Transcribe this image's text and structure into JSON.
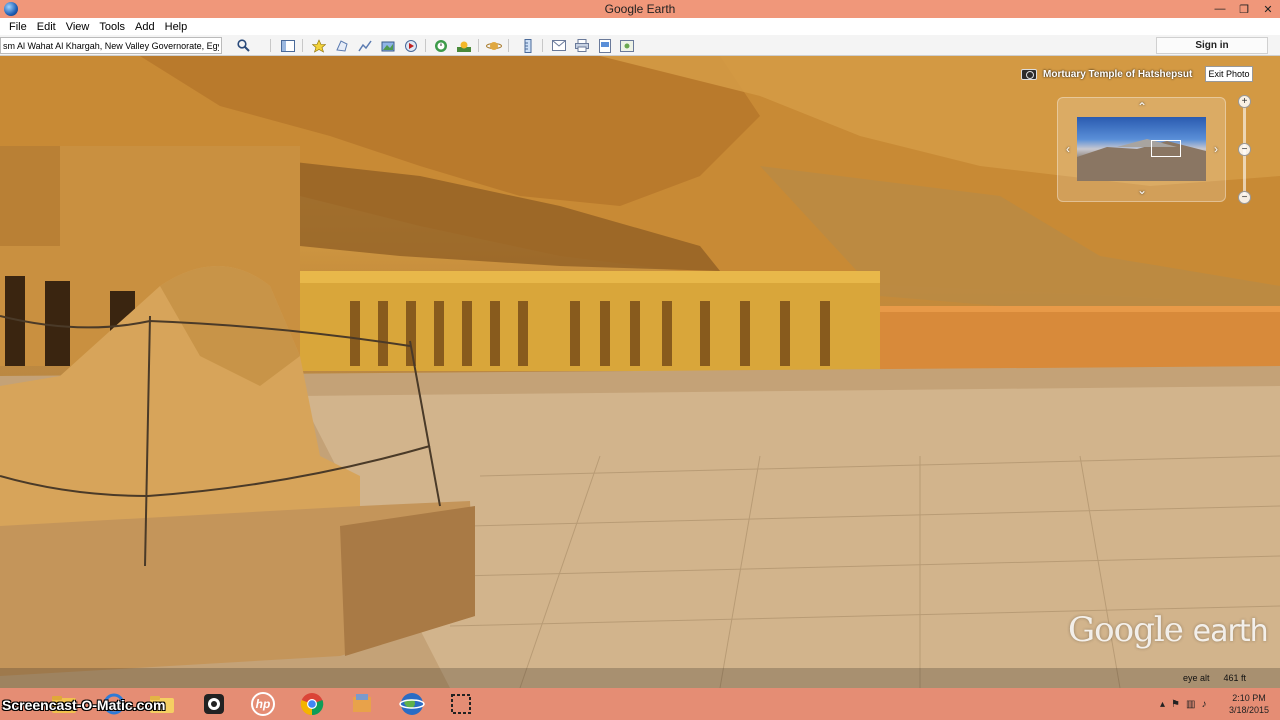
{
  "window": {
    "title": "Google Earth"
  },
  "window_controls": {
    "minimize": "—",
    "restore": "❐",
    "close": "✕"
  },
  "menu": [
    "File",
    "Edit",
    "View",
    "Tools",
    "Add",
    "Help"
  ],
  "toolbar": {
    "search_value": "sm Al Wahat Al Khargah, New Valley Governorate, Egypt",
    "sign_in_label": "Sign in",
    "tool_icons": [
      "search-icon",
      "sidebar-icon",
      "placemark-icon",
      "polygon-icon",
      "path-icon",
      "image-overlay-icon",
      "tour-icon",
      "historical-imagery-icon",
      "sun-icon",
      "planets-icon",
      "ruler-icon",
      "email-icon",
      "print-icon",
      "save-image-icon",
      "maps-icon"
    ]
  },
  "photo": {
    "title": "Mortuary Temple of Hatshepsut",
    "exit_label": "Exit Photo"
  },
  "navigator": {
    "up": "⌃",
    "down": "⌄",
    "left": "‹",
    "right": "›",
    "zoom_in": "+",
    "zoom_out": "−",
    "zoom_mid": "−"
  },
  "branding": {
    "google": "Google",
    "earth": "earth"
  },
  "status": {
    "eye_alt_label": "eye alt",
    "eye_alt_value": "461 ft"
  },
  "taskbar": {
    "recorder_label": "Screencast-O-Matic.com",
    "apps": [
      "windows-explorer-icon",
      "camera-app-icon",
      "hp-icon",
      "chrome-icon",
      "file-manager-icon",
      "google-earth-icon",
      "snipping-tool-icon"
    ],
    "hp_label": "hp",
    "time": "2:10 PM",
    "date": "3/18/2015"
  },
  "colors": {
    "titlebar": "#f0977a",
    "taskbar": "#e58d74",
    "sandstone": "#d9a54a"
  }
}
